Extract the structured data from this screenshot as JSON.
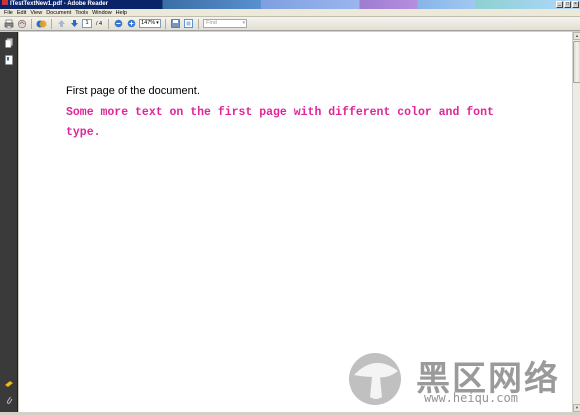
{
  "window": {
    "title": "ITestTextNew1.pdf - Adobe Reader",
    "controls": [
      "_",
      "□",
      "×"
    ]
  },
  "menu": [
    "File",
    "Edit",
    "View",
    "Document",
    "Tools",
    "Window",
    "Help"
  ],
  "toolbar": {
    "page_current": "1",
    "page_total": "/ 4",
    "zoom": "147%",
    "find_placeholder": "Find"
  },
  "document": {
    "line1": "First page of the document.",
    "line2": "Some more text on the first page with different color and font type."
  },
  "watermark": {
    "site_cn": "黑区网络",
    "url": "www.heiqu.com"
  },
  "colors": {
    "accent_text": "#e0259a",
    "title_bar": "#0a246a",
    "nav_pane": "#3a3a3a"
  }
}
